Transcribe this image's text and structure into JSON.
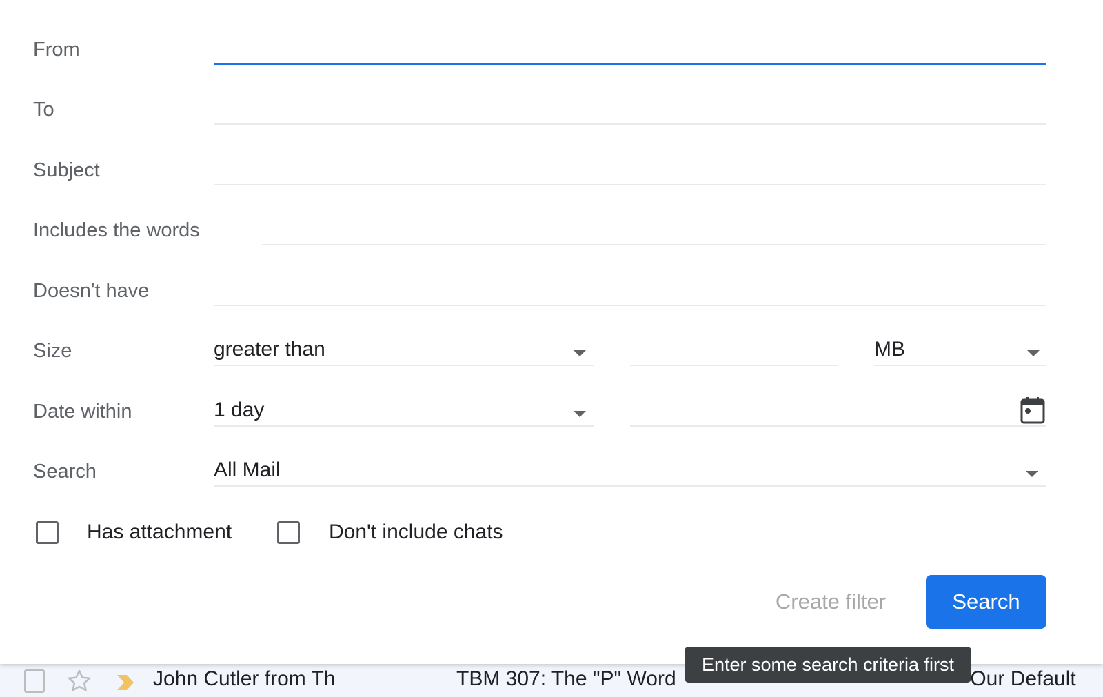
{
  "search_form": {
    "from": {
      "label": "From",
      "value": ""
    },
    "to": {
      "label": "To",
      "value": ""
    },
    "subject": {
      "label": "Subject",
      "value": ""
    },
    "includes_words": {
      "label": "Includes the words",
      "value": ""
    },
    "doesnt_have": {
      "label": "Doesn't have",
      "value": ""
    },
    "size": {
      "label": "Size",
      "operator": "greater than",
      "value": "",
      "unit": "MB"
    },
    "date_within": {
      "label": "Date within",
      "range": "1 day",
      "date": ""
    },
    "search_in": {
      "label": "Search",
      "value": "All Mail"
    },
    "has_attachment": {
      "label": "Has attachment",
      "checked": false
    },
    "dont_include_chats": {
      "label": "Don't include chats",
      "checked": false
    },
    "create_filter_label": "Create filter",
    "search_label": "Search",
    "accent_color": "#1a73e8"
  },
  "tooltip": {
    "text": "Enter some search criteria first"
  },
  "email_list": {
    "rows": [
      {
        "sender": "John Cutler from Th",
        "subject": "TBM 307: The \"P\" Word",
        "subject_tail": "Our Default",
        "starred": false,
        "important": true
      }
    ]
  }
}
